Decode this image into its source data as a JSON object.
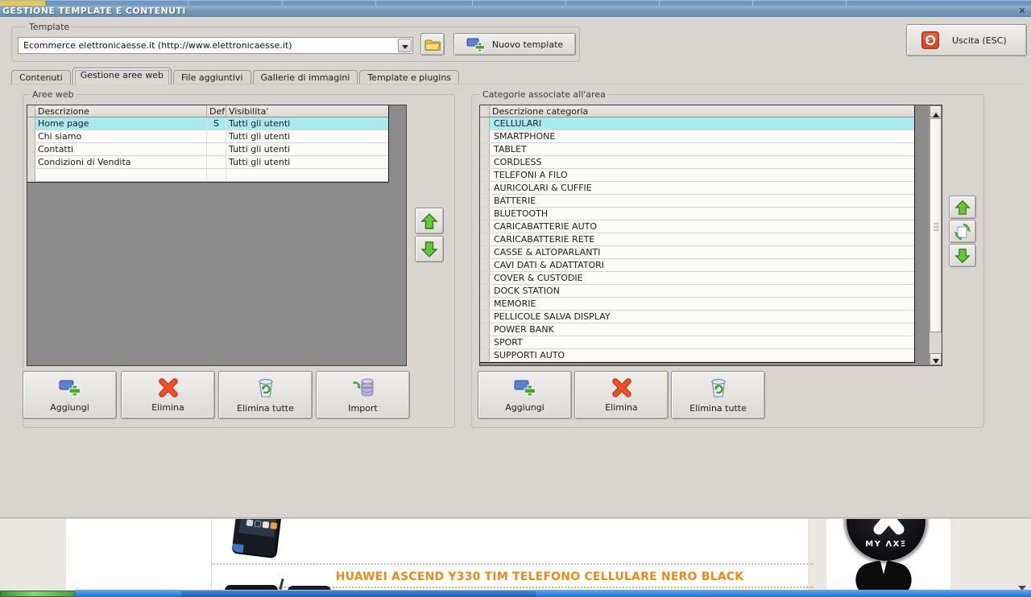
{
  "colors": {
    "accent_orange": "#ef8913",
    "selection_cyan": "#a9eaf0",
    "titlebar_blue": "#7497ba",
    "grid_gray": "#8c8c8c"
  },
  "window": {
    "title": "GESTIONE TEMPLATE E CONTENUTI",
    "close_icon": "✕"
  },
  "template": {
    "label": "Template",
    "combo_value": "Ecommerce elettronicaesse.it (http://www.elettronicaesse.it)",
    "new_button": "Nuovo template",
    "exit_button": "Uscita (ESC)"
  },
  "tabs": {
    "items": [
      {
        "label": "Contenuti"
      },
      {
        "label": "Gestione aree web"
      },
      {
        "label": "File aggiuntivi"
      },
      {
        "label": "Gallerie di immagini"
      },
      {
        "label": "Template e plugins"
      }
    ],
    "active": "Gestione aree web"
  },
  "aree_web": {
    "legend": "Aree web",
    "headers": {
      "descrizione": "Descrizione",
      "def": "Def",
      "visibilita": "Visibilita'"
    },
    "rows": [
      {
        "descrizione": "Home page",
        "def": "S",
        "visibilita": "Tutti gli utenti",
        "selected": true
      },
      {
        "descrizione": "Chi siamo",
        "def": "",
        "visibilita": "Tutti gli utenti",
        "selected": false
      },
      {
        "descrizione": "Contatti",
        "def": "",
        "visibilita": "Tutti gli utenti",
        "selected": false
      },
      {
        "descrizione": "Condizioni di Vendita",
        "def": "",
        "visibilita": "Tutti gli utenti",
        "selected": false
      }
    ],
    "buttons": {
      "aggiungi": "Aggiungi",
      "elimina": "Elimina",
      "elimina_tutte": "Elimina tutte",
      "import": "Import"
    }
  },
  "categorie": {
    "legend": "Categorie associate all'area",
    "header": "Descrizione categoria",
    "selected_index": 0,
    "items": [
      "CELLULARI",
      "SMARTPHONE",
      "TABLET",
      "CORDLESS",
      "TELEFONI A FILO",
      "AURICOLARI & CUFFIE",
      "BATTERIE",
      "BLUETOOTH",
      "CARICABATTERIE AUTO",
      "CARICABATTERIE RETE",
      "CASSE & ALTOPARLANTI",
      "CAVI DATI & ADATTATORI",
      "COVER & CUSTODIE",
      "DOCK STATION",
      "MEMORIE",
      "PELLICOLE SALVA DISPLAY",
      "POWER BANK",
      "SPORT",
      "SUPPORTI AUTO"
    ],
    "buttons": {
      "aggiungi": "Aggiungi",
      "elimina": "Elimina",
      "elimina_tutte": "Elimina tutte"
    }
  },
  "preview": {
    "product_link": "HUAWEI ASCEND Y330 TIM TELEFONO CELLULARE NERO BLACK",
    "logo_text": "MY ΛXΞ"
  }
}
